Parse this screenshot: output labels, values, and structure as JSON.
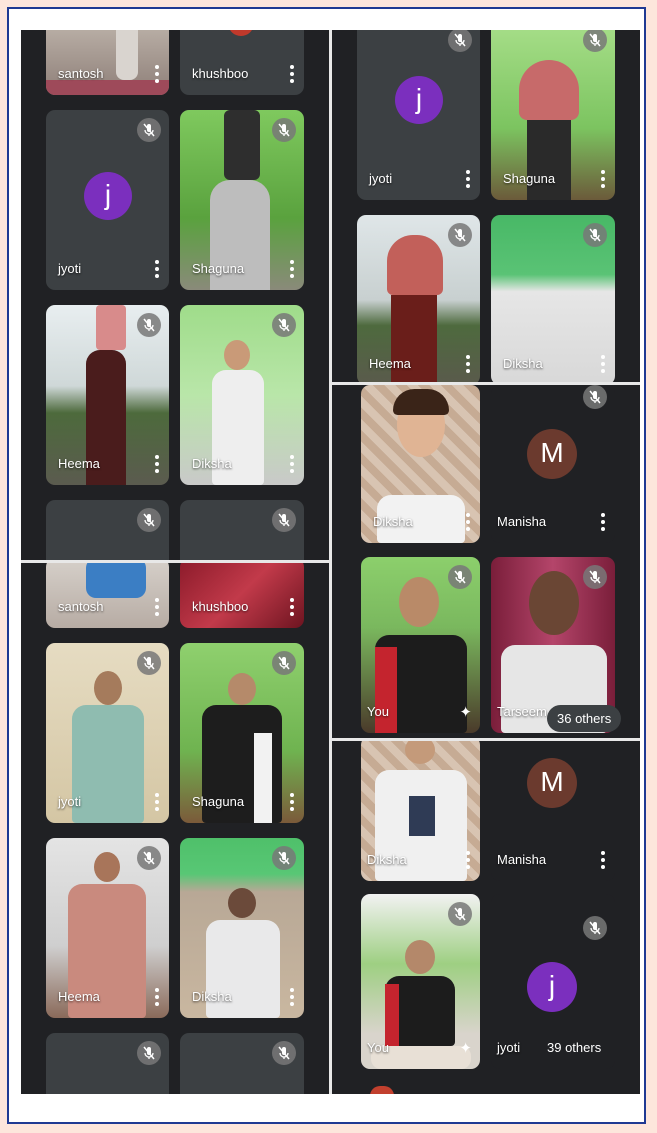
{
  "colors": {
    "tile_dark": "#3c4043",
    "background": "#202124",
    "avatar_purple": "#7b2fbe",
    "avatar_brown": "#6b3a2e",
    "page_bg": "#fde6dc",
    "frame_border": "#1f3a93"
  },
  "panels": {
    "top_left": {
      "tiles": [
        {
          "name": "santosh"
        },
        {
          "name": "khushboo"
        },
        {
          "name": "jyoti",
          "avatar_letter": "j"
        },
        {
          "name": "Shaguna"
        },
        {
          "name": "Heema"
        },
        {
          "name": "Diksha"
        }
      ]
    },
    "bottom_left": {
      "tiles": [
        {
          "name": "santosh"
        },
        {
          "name": "khushboo"
        },
        {
          "name": "jyoti"
        },
        {
          "name": "Shaguna"
        },
        {
          "name": "Heema"
        },
        {
          "name": "Diksha"
        }
      ]
    },
    "top_right": {
      "tiles": [
        {
          "name": "jyoti",
          "avatar_letter": "j"
        },
        {
          "name": "Shaguna"
        },
        {
          "name": "Heema"
        },
        {
          "name": "Diksha"
        }
      ]
    },
    "middle_right": {
      "tiles": [
        {
          "name": "Diksha"
        },
        {
          "name": "Manisha",
          "avatar_letter": "M"
        },
        {
          "name": "You"
        },
        {
          "name": "Tarseem"
        }
      ],
      "others": "36 others"
    },
    "bottom_right": {
      "tiles": [
        {
          "name": "Diksha"
        },
        {
          "name": "Manisha",
          "avatar_letter": "M"
        },
        {
          "name": "You"
        },
        {
          "name": "jyoti",
          "avatar_letter": "j"
        }
      ],
      "others": "39 others"
    }
  }
}
